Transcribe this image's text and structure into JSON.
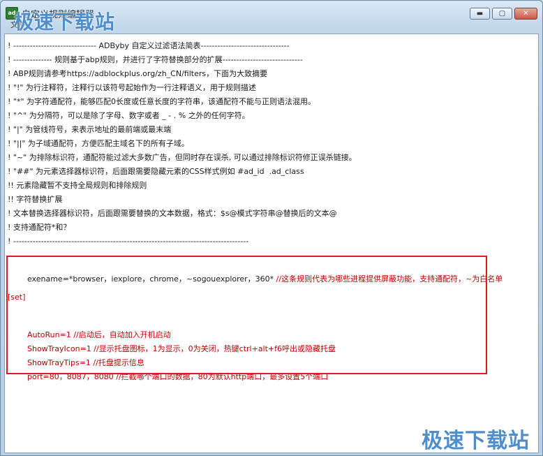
{
  "window": {
    "title": "自定义规则编辑器",
    "menu": "文件",
    "controls": {
      "minimize": "▬",
      "maximize": "▢",
      "close": "✕"
    }
  },
  "editor": {
    "lines": [
      "! ------------------------------ ADByby 自定义过滤语法简表--------------------------------",
      "! -------------- 规则基于abp规则，并进行了字符替换部分的扩展-----------------------------",
      "! ABP规则请参考https://adblockplus.org/zh_CN/filters，下面为大致摘要",
      "! \"!\" 为行注释符，注释行以该符号起始作为一行注释语义，用于规则描述",
      "! \"*\" 为字符通配符，能够匹配0长度或任意长度的字符串，该通配符不能与正则语法混用。",
      "! \"^\" 为分隔符，可以是除了字母、数字或者 _ - . % 之外的任何字符。",
      "! \"|\" 为管线符号，来表示地址的最前端或最末端",
      "! \"||\" 为子域通配符，方便匹配主域名下的所有子域。",
      "! \"~\" 为排除标识符，通配符能过滤大多数广告，但同时存在误杀, 可以通过排除标识符修正误杀链接。",
      "! \"##\" 为元素选择器标识符，后面跟需要隐藏元素的CSS样式例如 #ad_id  .ad_class",
      "!! 元素隐藏暂不支持全局规则和排除规则",
      "!! 字符替换扩展",
      "! 文本替换选择器标识符，后面跟需要替换的文本数据，格式：$s@模式字符串@替换后的文本@",
      "! 支持通配符*和？",
      "! -------------------------------------------------------------------------------------"
    ],
    "config": {
      "exename_key": "exename=*browser，iexplore，chrome，~sogouexplorer，360* ",
      "exename_comment": "//这条规则代表为哪些进程提供屏蔽功能，支持通配符，~为白名单",
      "section": "[set]",
      "autorun_key": "AutoRun=1 ",
      "autorun_comment": "//启动后，自动加入开机启动",
      "trayicon_key": "ShowTrayIcon=1 ",
      "trayicon_comment": "//显示托盘图标，1为显示，0为关闭，热键ctrl+alt+f6呼出或隐藏托盘",
      "traytips_key": "ShowTrayTips=1 ",
      "traytips_comment": "//托盘提示信息",
      "port_key": "port=80，8087，8080 ",
      "port_comment": "//拦截哪个端口的数据，80为默认http端口，最多设置5个端口"
    }
  },
  "watermark": {
    "text": "极速下载站"
  }
}
